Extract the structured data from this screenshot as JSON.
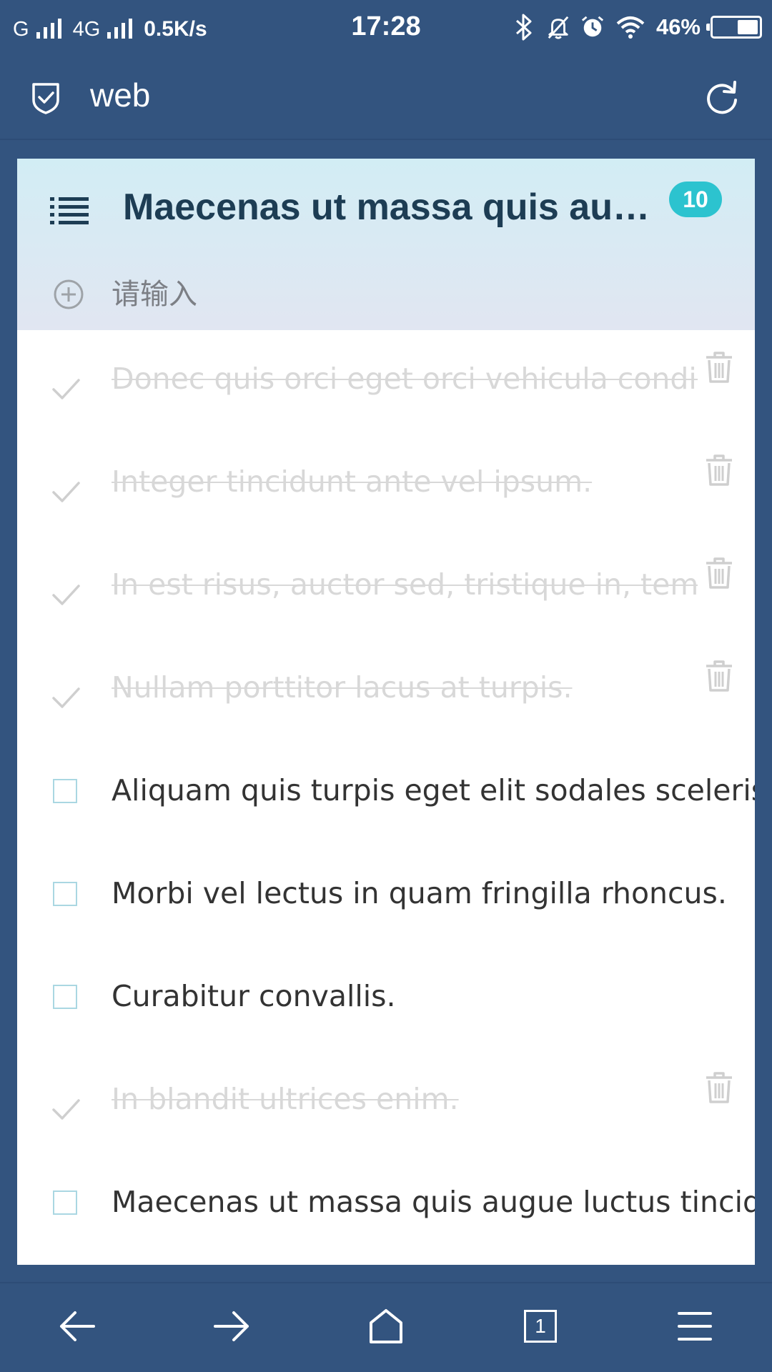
{
  "status_bar": {
    "carrier1": "G",
    "carrier2": "4G",
    "speed": "0.5K/s",
    "time": "17:28",
    "battery": "46%",
    "battery_level": 0.46,
    "icons": [
      "bluetooth-icon",
      "mute-icon",
      "alarm-icon",
      "wifi-icon",
      "battery-icon"
    ]
  },
  "app_bar": {
    "title": "web",
    "icons": [
      "shield-icon",
      "refresh-icon"
    ]
  },
  "list": {
    "title": "Maecenas ut massa quis augue luctus tincidunt.",
    "count": "10",
    "add_placeholder": "请输入",
    "items": [
      {
        "text": "Donec quis orci eget orci vehicula condimentum.",
        "done": true
      },
      {
        "text": "Integer tincidunt ante vel ipsum.",
        "done": true
      },
      {
        "text": "In est risus, auctor sed, tristique in, tempus sit amet, sem.",
        "done": true
      },
      {
        "text": "Nullam porttitor lacus at turpis.",
        "done": true
      },
      {
        "text": "Aliquam quis turpis eget elit sodales scelerisque.",
        "done": false
      },
      {
        "text": "Morbi vel lectus in quam fringilla rhoncus.",
        "done": false
      },
      {
        "text": "Curabitur convallis.",
        "done": false
      },
      {
        "text": "In blandit ultrices enim.",
        "done": true
      },
      {
        "text": "Maecenas ut massa quis augue luctus tincidunt.",
        "done": false
      }
    ]
  },
  "bottom_nav": {
    "tab_count": "1",
    "icons": [
      "back-icon",
      "forward-icon",
      "home-icon",
      "tabs-icon",
      "menu-icon"
    ]
  },
  "colors": {
    "chrome": "#33547f",
    "header_gradient_top": "#d2edf4",
    "badge": "#2cc3cf",
    "title": "#1d3d54"
  }
}
